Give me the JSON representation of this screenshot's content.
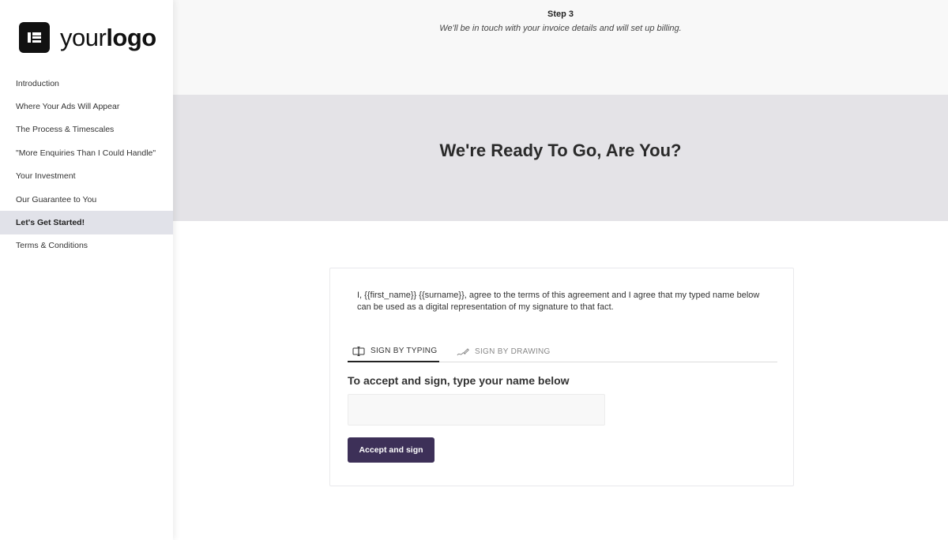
{
  "logo": {
    "text_regular": "your",
    "text_bold": "logo",
    "icon": "logo-mark-icon"
  },
  "nav": {
    "items": [
      {
        "label": "Introduction",
        "active": false
      },
      {
        "label": "Where Your Ads Will Appear",
        "active": false
      },
      {
        "label": "The Process & Timescales",
        "active": false
      },
      {
        "label": "\"More Enquiries Than I Could Handle\"",
        "active": false
      },
      {
        "label": "Your Investment",
        "active": false
      },
      {
        "label": "Our Guarantee to You",
        "active": false
      },
      {
        "label": "Let's Get Started!",
        "active": true
      },
      {
        "label": "Terms & Conditions",
        "active": false
      }
    ]
  },
  "step": {
    "title": "Step 3",
    "text": "We'll be in touch with your invoice details and will set up billing."
  },
  "banner": {
    "title": "We're Ready To Go, Are You?"
  },
  "signature": {
    "agreement_text": "I, {{first_name}} {{surname}}, agree to the terms of this agreement and I agree that my typed name below can be used as a digital representation of my signature to that fact.",
    "tabs": [
      {
        "label": "SIGN BY TYPING",
        "icon": "keyboard-cursor-icon",
        "active": true
      },
      {
        "label": "SIGN BY DRAWING",
        "icon": "pen-signature-icon",
        "active": false
      }
    ],
    "heading": "To accept and sign, type your name below",
    "input_value": "",
    "button_label": "Accept and sign"
  },
  "colors": {
    "accent": "#3d3058",
    "active_nav_bg": "#e1e2e9",
    "banner_bg": "#e4e3e7",
    "step_bg": "#f8f8f8"
  }
}
